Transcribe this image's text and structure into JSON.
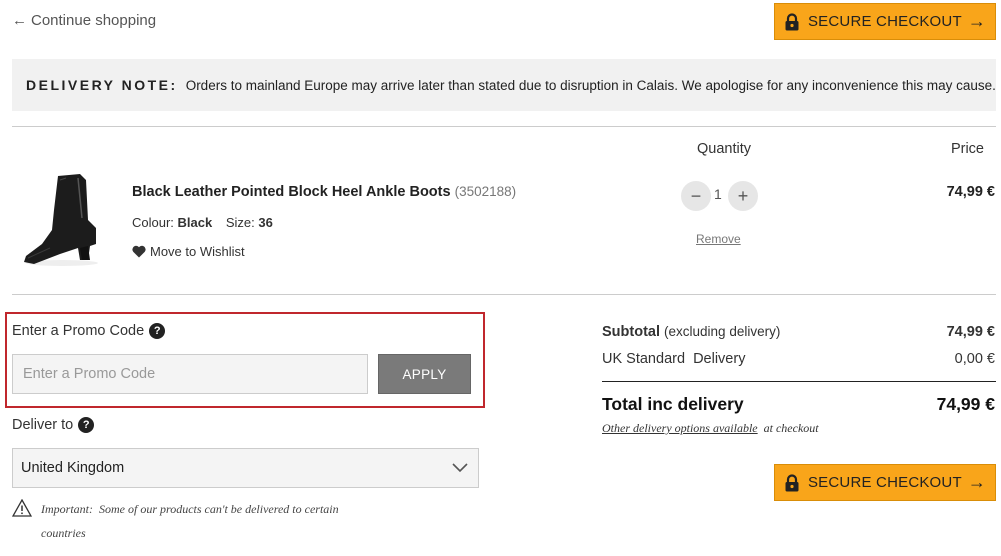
{
  "nav": {
    "continue_label": "Continue shopping"
  },
  "checkout": {
    "label": "SECURE CHECKOUT"
  },
  "delivery_note": {
    "title": "DELIVERY NOTE:",
    "text": "Orders to mainland Europe may arrive later than stated due to disruption in Calais. We apologise for any inconvenience this may cause."
  },
  "columns": {
    "quantity": "Quantity",
    "price": "Price"
  },
  "item": {
    "name": "Black Leather Pointed Block Heel Ankle Boots",
    "code": "(3502188)",
    "colour_label": "Colour:",
    "colour_value": "Black",
    "size_label": "Size:",
    "size_value": "36",
    "wishlist_label": "Move to Wishlist",
    "quantity": "1",
    "remove_label": "Remove",
    "price": "74,99 €"
  },
  "promo": {
    "label": "Enter a Promo Code",
    "placeholder": "Enter a Promo Code",
    "apply_label": "APPLY"
  },
  "deliver": {
    "label": "Deliver to",
    "selected": "United Kingdom",
    "important_label": "Important:",
    "important_text": "Some of our products can't be delivered to certain countries"
  },
  "summary": {
    "subtotal_label": "Subtotal",
    "subtotal_note": "(excluding delivery)",
    "subtotal_value": "74,99 €",
    "delivery_label": "UK Standard  Delivery",
    "delivery_value": "0,00 €",
    "total_label": "Total inc delivery",
    "total_value": "74,99 €",
    "other_link": "Other delivery options available",
    "other_suffix": "at checkout"
  },
  "colors": {
    "accent": "#f9a51a",
    "highlight_border": "#c0272d",
    "apply_bg": "#7a7a7a"
  }
}
